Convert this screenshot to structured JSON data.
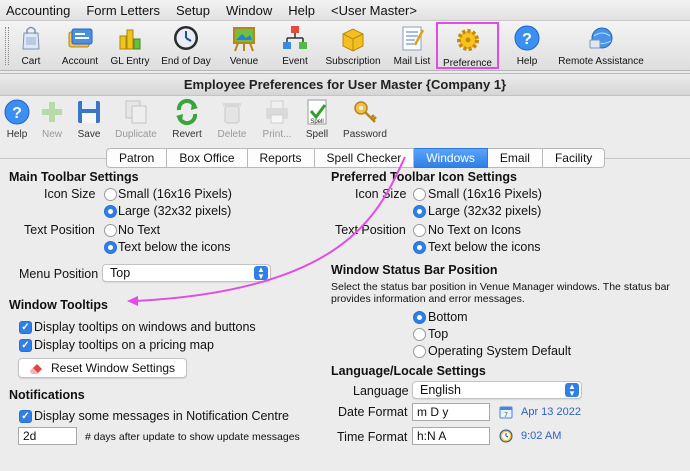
{
  "menubar": {
    "items": [
      "Accounting",
      "Form Letters",
      "Setup",
      "Window",
      "Help",
      "<User Master>"
    ]
  },
  "main_toolbar": {
    "buttons": [
      {
        "label": "Cart",
        "icon": "cart-icon"
      },
      {
        "label": "Account",
        "icon": "account-icon"
      },
      {
        "label": "GL Entry",
        "icon": "gl-entry-icon"
      },
      {
        "label": "End of Day",
        "icon": "end-of-day-clock-icon"
      },
      {
        "label": "Venue",
        "icon": "venue-easel-icon"
      },
      {
        "label": "Event",
        "icon": "event-network-icon"
      },
      {
        "label": "Subscription",
        "icon": "subscription-box-icon"
      },
      {
        "label": "Mail List",
        "icon": "mail-list-icon"
      },
      {
        "label": "Preference",
        "icon": "preference-gear-icon"
      },
      {
        "label": "Help",
        "icon": "help-icon"
      },
      {
        "label": "Remote Assistance",
        "icon": "remote-assistance-icon"
      }
    ],
    "highlight_color": "#e24ce6"
  },
  "window": {
    "title": "Employee Preferences for User Master {Company 1}",
    "toolbar": [
      {
        "label": "Help",
        "enabled": true
      },
      {
        "label": "New",
        "enabled": false
      },
      {
        "label": "Save",
        "enabled": true
      },
      {
        "label": "Duplicate",
        "enabled": false
      },
      {
        "label": "Revert",
        "enabled": true
      },
      {
        "label": "Delete",
        "enabled": false
      },
      {
        "label": "Print...",
        "enabled": false
      },
      {
        "label": "Spell",
        "enabled": true
      },
      {
        "label": "Password",
        "enabled": true
      }
    ],
    "tabs": [
      "Patron",
      "Box Office",
      "Reports",
      "Spell Checker",
      "Windows",
      "Email",
      "Facility"
    ],
    "active_tab": "Windows"
  },
  "main_toolbar_settings": {
    "heading": "Main Toolbar Settings",
    "icon_size_label": "Icon Size",
    "icon_size_options": [
      "Small (16x16 Pixels)",
      "Large (32x32 pixels)"
    ],
    "icon_size_selected": "Large (32x32 pixels)",
    "text_position_label": "Text Position",
    "text_position_options": [
      "No Text",
      "Text below the icons"
    ],
    "text_position_selected": "Text below the icons",
    "menu_position_label": "Menu Position",
    "menu_position_value": "Top"
  },
  "window_tooltips": {
    "heading": "Window Tooltips",
    "option1": "Display tooltips on windows and buttons",
    "option2": "Display tooltips on a pricing map",
    "option1_checked": true,
    "option2_checked": true,
    "reset_button": "Reset Window Settings"
  },
  "notifications": {
    "heading": "Notifications",
    "option": "Display some messages in Notification Centre",
    "option_checked": true,
    "days_value": "2d",
    "days_label": "# days after update to show update messages"
  },
  "preferred_toolbar": {
    "heading": "Preferred Toolbar Icon Settings",
    "icon_size_label": "Icon Size",
    "icon_size_options": [
      "Small (16x16 Pixels)",
      "Large (32x32 pixels)"
    ],
    "icon_size_selected": "Large (32x32 pixels)",
    "text_position_label": "Text Position",
    "text_position_options": [
      "No Text on Icons",
      "Text below the icons"
    ],
    "text_position_selected": "Text below the icons"
  },
  "status_bar": {
    "heading": "Window Status Bar Position",
    "description_line1": "Select the status bar position in Venue Manager windows.  The status bar",
    "description_line2": "provides information and error messages.",
    "options": [
      "Bottom",
      "Top",
      "Operating System Default"
    ],
    "selected": "Bottom"
  },
  "locale": {
    "heading": "Language/Locale Settings",
    "language_label": "Language",
    "language_value": "English",
    "date_format_label": "Date Format",
    "date_format_value": "m D y",
    "date_example": "Apr 13 2022",
    "time_format_label": "Time Format",
    "time_format_value": "h:N A",
    "time_example": "9:02 AM"
  },
  "colors": {
    "accent": "#2f7fe6",
    "annotation": "#e24ce6"
  }
}
